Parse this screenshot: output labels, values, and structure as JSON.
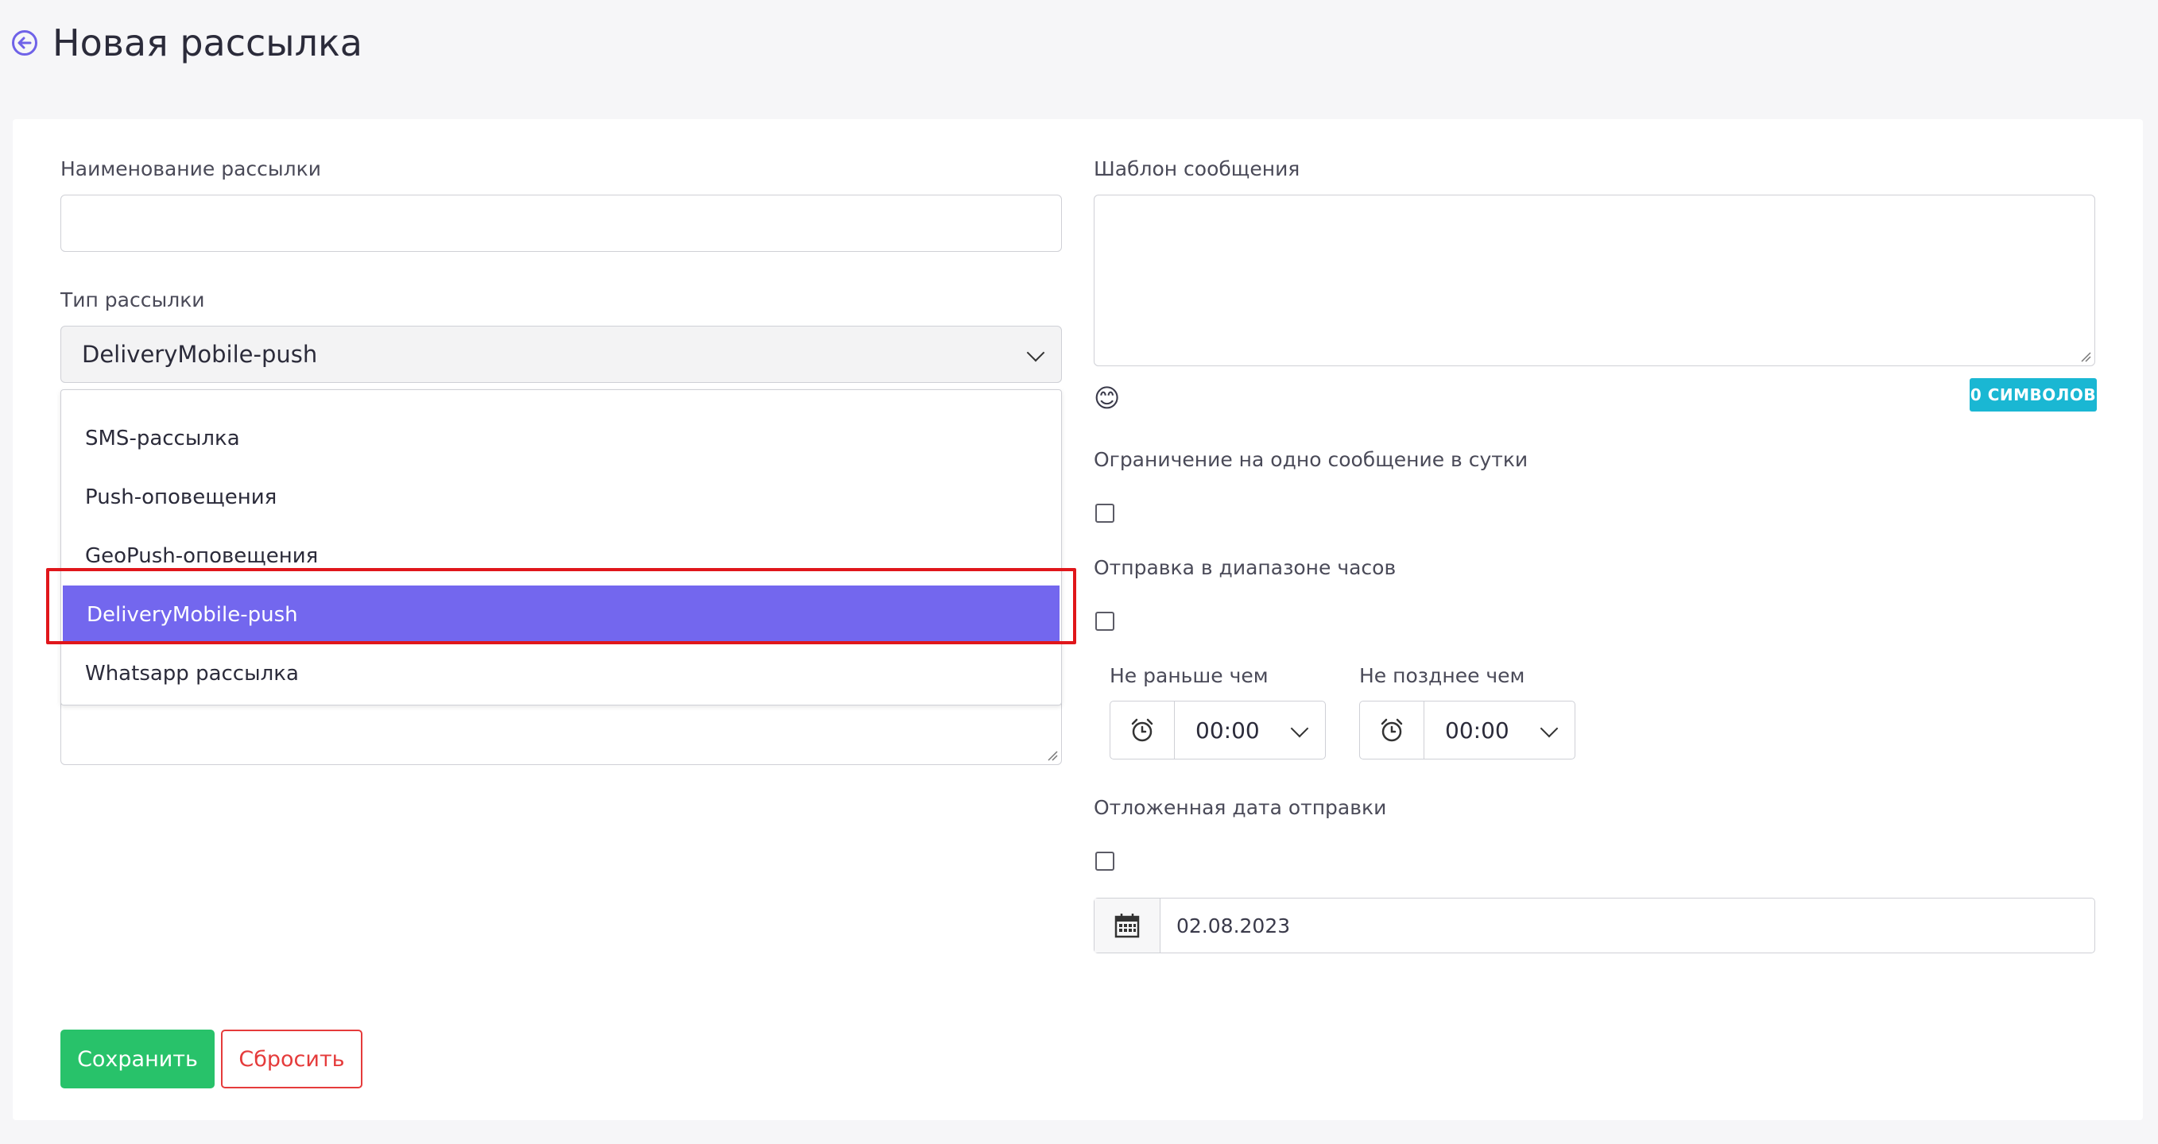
{
  "header": {
    "title": "Новая рассылка"
  },
  "form": {
    "name_label": "Наименование рассылки",
    "name_value": "",
    "type_label": "Тип рассылки",
    "type_selected": "DeliveryMobile-push",
    "type_options": [
      "SMS-рассылка",
      "Push-оповещения",
      "GeoPush-оповещения",
      "DeliveryMobile-push",
      "Whatsapp рассылка"
    ],
    "template_label": "Шаблон сообщения",
    "template_value": "",
    "char_counter": "0 СИМВОЛОВ",
    "emoji": "😊",
    "limit_label": "Ограничение на одно сообщение в сутки",
    "range_label": "Отправка в диапазоне часов",
    "not_earlier_label": "Не раньше чем",
    "not_earlier_value": "00:00",
    "not_later_label": "Не позднее чем",
    "not_later_value": "00:00",
    "delayed_label": "Отложенная дата отправки",
    "delayed_date": "02.08.2023"
  },
  "actions": {
    "save_label": "Сохранить",
    "reset_label": "Сбросить"
  },
  "colors": {
    "accent": "#7367ee",
    "save": "#28c26a",
    "reset": "#e53b3b",
    "badge": "#1ab7d3",
    "highlight": "#e0161b"
  },
  "icons": [
    "back-arrow-icon",
    "chevron-down-icon",
    "alarm-clock-icon",
    "calendar-icon",
    "resize-grip-icon"
  ]
}
